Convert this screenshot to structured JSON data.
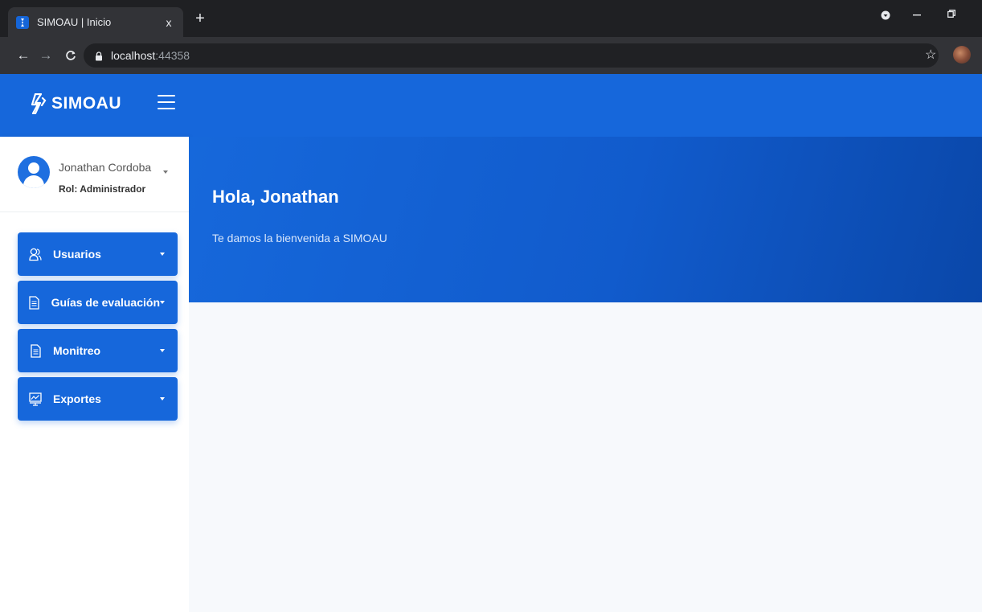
{
  "browser": {
    "tab_title": "SIMOAU | Inicio",
    "tab_close": "x",
    "new_tab": "+",
    "url_host": "localhost",
    "url_port": ":44358"
  },
  "app": {
    "brand": "SIMOAU",
    "colors": {
      "primary": "#1667db",
      "hero_dark": "#0a47a9",
      "background": "#f7f9fc"
    }
  },
  "user": {
    "name": "Jonathan Cordoba",
    "role": "Rol: Administrador"
  },
  "menu": [
    {
      "label": "Usuarios",
      "icon": "users-icon"
    },
    {
      "label": "Guías de evaluación",
      "icon": "document-icon"
    },
    {
      "label": "Monitreo",
      "icon": "document-icon"
    },
    {
      "label": "Exportes",
      "icon": "presentation-chart-icon"
    }
  ],
  "hero": {
    "greeting": "Hola, Jonathan",
    "subtitle": "Te damos la bienvenida a SIMOAU"
  }
}
